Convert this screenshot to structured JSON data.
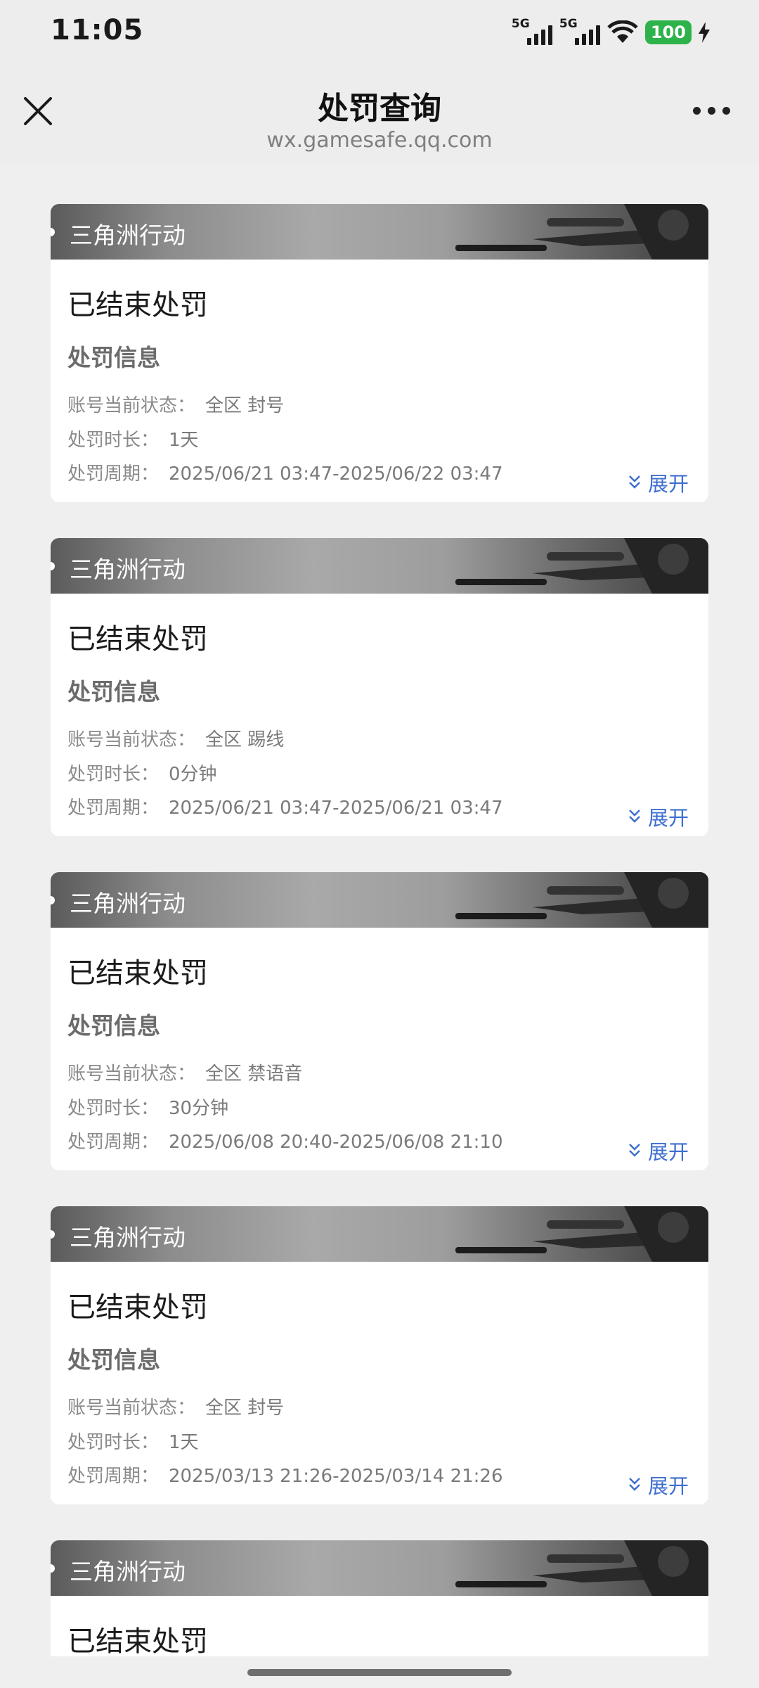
{
  "status_bar": {
    "time": "11:05",
    "network": "5G",
    "battery": "100"
  },
  "header": {
    "title": "处罚查询",
    "subtitle": "wx.gamesafe.qq.com"
  },
  "labels": {
    "section": "处罚信息",
    "status_label": "账号当前状态：",
    "duration_label": "处罚时长：",
    "period_label": "处罚周期：",
    "expand": "展开"
  },
  "cards": [
    {
      "game": "三角洲行动",
      "state": "已结束处罚",
      "status": "全区 封号",
      "duration": "1天",
      "period": "2025/06/21 03:47-2025/06/22 03:47"
    },
    {
      "game": "三角洲行动",
      "state": "已结束处罚",
      "status": "全区 踢线",
      "duration": "0分钟",
      "period": "2025/06/21 03:47-2025/06/21 03:47"
    },
    {
      "game": "三角洲行动",
      "state": "已结束处罚",
      "status": "全区 禁语音",
      "duration": "30分钟",
      "period": "2025/06/08 20:40-2025/06/08 21:10"
    },
    {
      "game": "三角洲行动",
      "state": "已结束处罚",
      "status": "全区 封号",
      "duration": "1天",
      "period": "2025/03/13 21:26-2025/03/14 21:26"
    },
    {
      "game": "三角洲行动",
      "state": "已结束处罚"
    }
  ],
  "colors": {
    "accent": "#3e6fcf",
    "battery": "#2db34a",
    "background": "#efefef"
  }
}
